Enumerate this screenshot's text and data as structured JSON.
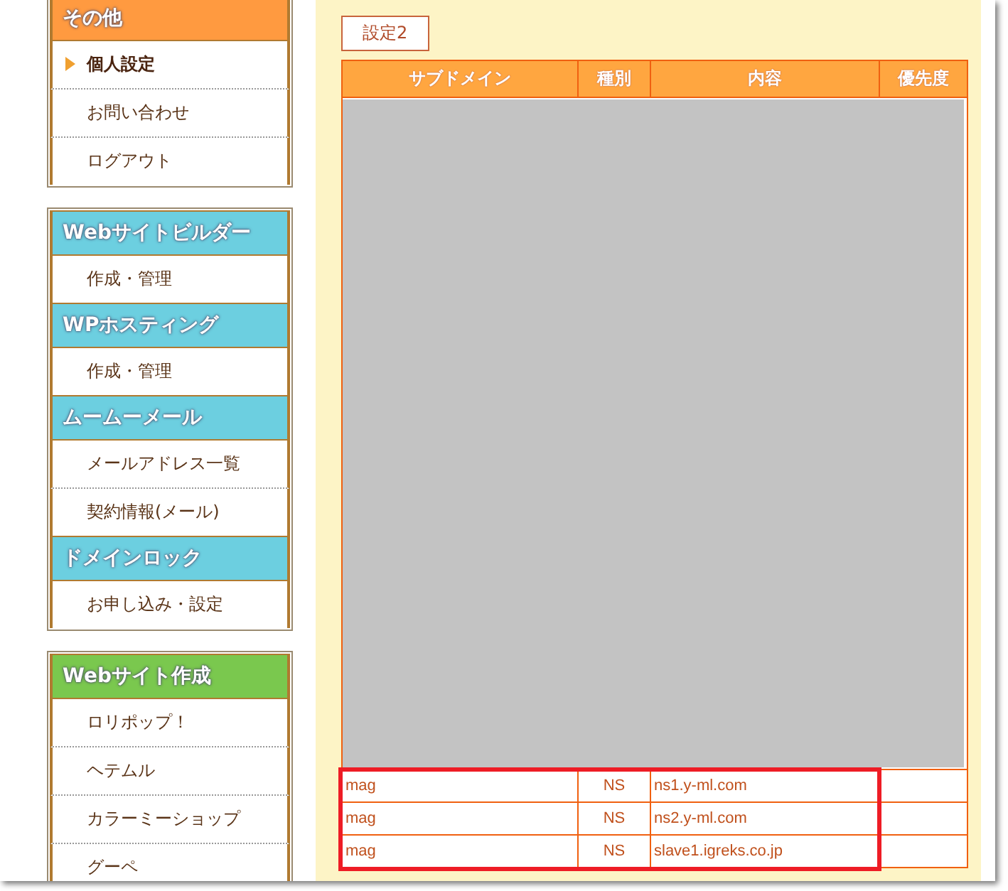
{
  "sidebar": [
    {
      "sections": [
        {
          "title": "その他",
          "kind": "other",
          "items": [
            {
              "label": "個人設定",
              "selected": true
            },
            {
              "label": "お問い合わせ",
              "selected": false
            },
            {
              "label": "ログアウト",
              "selected": false
            }
          ]
        }
      ]
    },
    {
      "sections": [
        {
          "title": "Webサイトビルダー",
          "kind": "service",
          "items": [
            {
              "label": "作成・管理",
              "selected": false
            }
          ]
        },
        {
          "title": "WPホスティング",
          "kind": "service",
          "items": [
            {
              "label": "作成・管理",
              "selected": false
            }
          ]
        },
        {
          "title": "ムームーメール",
          "kind": "service",
          "items": [
            {
              "label": "メールアドレス一覧",
              "selected": false
            },
            {
              "label": "契約情報(メール)",
              "selected": false
            }
          ]
        },
        {
          "title": "ドメインロック",
          "kind": "service",
          "items": [
            {
              "label": "お申し込み・設定",
              "selected": false
            }
          ]
        }
      ]
    },
    {
      "sections": [
        {
          "title": "Webサイト作成",
          "kind": "site",
          "items": [
            {
              "label": "ロリポップ！",
              "selected": false
            },
            {
              "label": "ヘテムル",
              "selected": false
            },
            {
              "label": "カラーミーショップ",
              "selected": false
            },
            {
              "label": "グーペ",
              "selected": false
            }
          ]
        }
      ]
    }
  ],
  "main": {
    "tab": "設定2",
    "table": {
      "columns": [
        "サブドメイン",
        "種別",
        "内容",
        "優先度"
      ],
      "rows": [
        [
          "mag",
          "NS",
          "ns1.y-ml.com",
          ""
        ],
        [
          "mag",
          "NS",
          "ns2.y-ml.com",
          ""
        ],
        [
          "mag",
          "NS",
          "slave1.igreks.co.jp",
          ""
        ]
      ]
    }
  }
}
